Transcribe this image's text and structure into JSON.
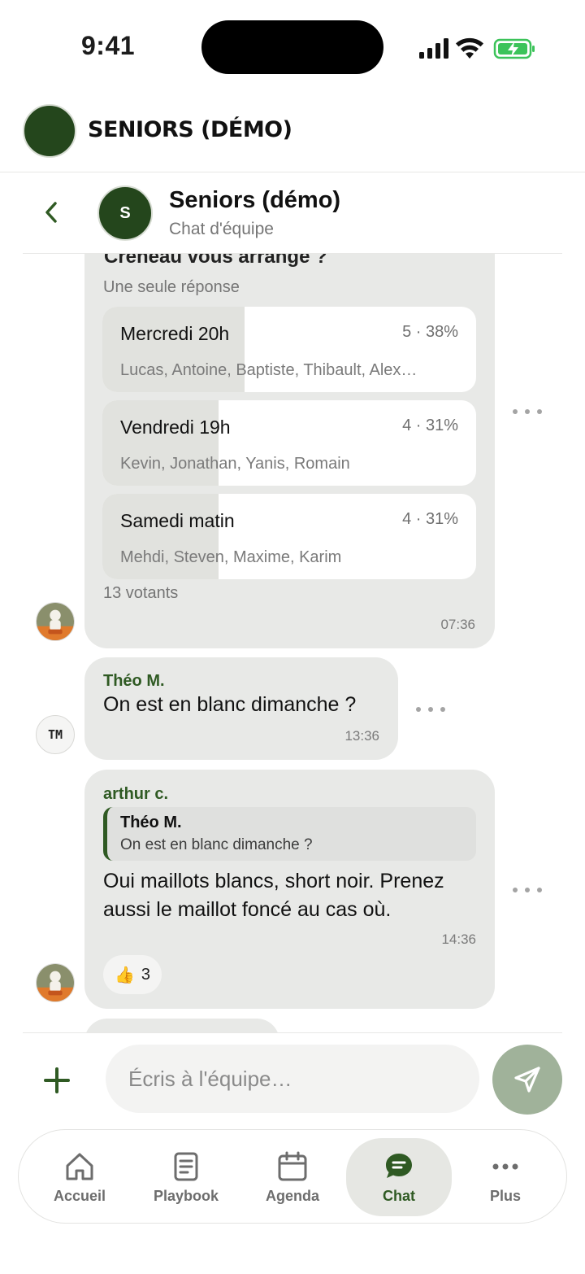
{
  "status_bar": {
    "time": "9:41"
  },
  "team": {
    "name": "SENIORS (DÉMO)"
  },
  "chat_header": {
    "avatar_letter": "S",
    "title": "Seniors (démo)",
    "subtitle": "Chat d'équipe"
  },
  "poll": {
    "question": "Créneau vous arrange ?",
    "type": "Une seule réponse",
    "options": [
      {
        "label": "Mercredi 20h",
        "count": "5 · 38%",
        "percent": 38,
        "voters": "Lucas, Antoine, Baptiste, Thibault, Alex…"
      },
      {
        "label": "Vendredi 19h",
        "count": "4 · 31%",
        "percent": 31,
        "voters": "Kevin, Jonathan, Yanis, Romain"
      },
      {
        "label": "Samedi matin",
        "count": "4 · 31%",
        "percent": 31,
        "voters": "Mehdi, Steven, Maxime, Karim"
      }
    ],
    "total": "13 votants",
    "time": "07:36"
  },
  "message_theo": {
    "initials": "TM",
    "sender": "Théo M.",
    "text": "On est en blanc dimanche ?",
    "time": "13:36"
  },
  "message_arthur": {
    "sender": "arthur c.",
    "reply": {
      "sender": "Théo M.",
      "text": "On est en blanc dimanche ?"
    },
    "text": "Oui maillots blancs, short noir. Prenez aussi le maillot foncé au cas où.",
    "time": "14:36",
    "reaction": {
      "emoji": "👍",
      "count": "3"
    }
  },
  "composer": {
    "placeholder": "Écris à l'équipe…"
  },
  "nav": {
    "items": [
      {
        "label": "Accueil",
        "icon": "home-icon"
      },
      {
        "label": "Playbook",
        "icon": "document-icon"
      },
      {
        "label": "Agenda",
        "icon": "calendar-icon"
      },
      {
        "label": "Chat",
        "icon": "chat-icon",
        "active": true
      },
      {
        "label": "Plus",
        "icon": "more-icon"
      }
    ]
  },
  "colors": {
    "accent": "#2f5a23",
    "team_dark": "#24461c",
    "bubble": "#e8e9e7",
    "send": "#a0b29a"
  }
}
